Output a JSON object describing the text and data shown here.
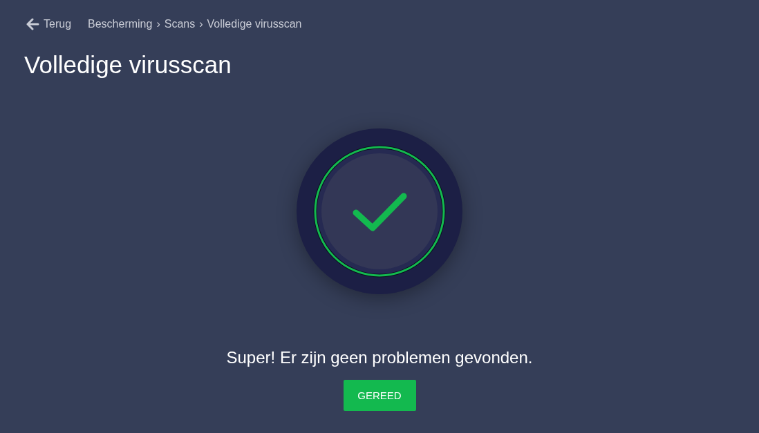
{
  "back": {
    "label": "Terug"
  },
  "breadcrumb": {
    "separator": "›",
    "items": [
      "Bescherming",
      "Scans",
      "Volledige virusscan"
    ]
  },
  "title": "Volledige virusscan",
  "result": {
    "kind": "success",
    "message": "Super! Er zijn geen problemen gevonden."
  },
  "button": {
    "label": "GEREED"
  }
}
